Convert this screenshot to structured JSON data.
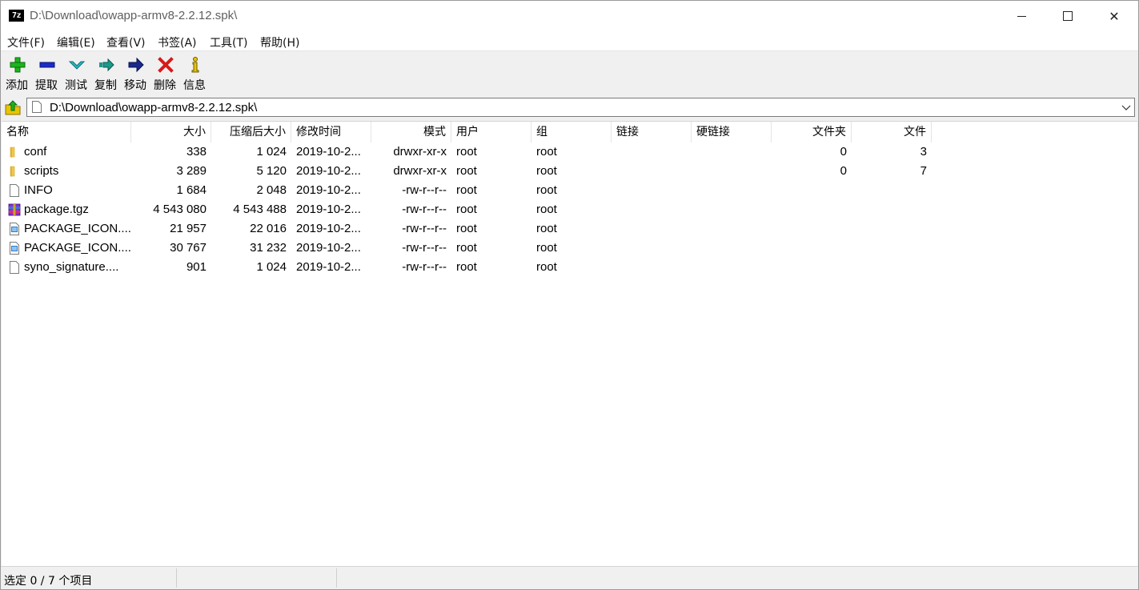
{
  "window": {
    "app_icon_text": "7z",
    "title": "D:\\Download\\owapp-armv8-2.2.12.spk\\",
    "minimize_label": "",
    "maximize_label": "",
    "close_label": "✕"
  },
  "menu": [
    {
      "label": "文件(F)"
    },
    {
      "label": "编辑(E)"
    },
    {
      "label": "查看(V)"
    },
    {
      "label": "书签(A)"
    },
    {
      "label": "工具(T)"
    },
    {
      "label": "帮助(H)"
    }
  ],
  "toolbar": [
    {
      "label": "添加",
      "icon": "add-icon",
      "color": "#1db31d"
    },
    {
      "label": "提取",
      "icon": "extract-icon",
      "color": "#1b2ccc"
    },
    {
      "label": "测试",
      "icon": "test-icon",
      "color": "#27b9c8"
    },
    {
      "label": "复制",
      "icon": "copy-icon",
      "color": "#1a9a8a"
    },
    {
      "label": "移动",
      "icon": "move-icon",
      "color": "#1a2a8a"
    },
    {
      "label": "删除",
      "icon": "delete-icon",
      "color": "#d61a1a"
    },
    {
      "label": "信息",
      "icon": "info-icon",
      "color": "#e8c400"
    }
  ],
  "address": {
    "path": "D:\\Download\\owapp-armv8-2.2.12.spk\\"
  },
  "columns": [
    {
      "label": "名称"
    },
    {
      "label": "大小"
    },
    {
      "label": "压缩后大小"
    },
    {
      "label": "修改时间"
    },
    {
      "label": "模式"
    },
    {
      "label": "用户"
    },
    {
      "label": "组"
    },
    {
      "label": "链接"
    },
    {
      "label": "硬链接"
    },
    {
      "label": "文件夹"
    },
    {
      "label": "文件"
    }
  ],
  "rows": [
    {
      "icon": "folder-icon",
      "name": "conf",
      "size": "338",
      "packed": "1 024",
      "modified": "2019-10-2...",
      "mode": "drwxr-xr-x",
      "user": "root",
      "group": "root",
      "link": "",
      "hardlink": "",
      "folders": "0",
      "files": "3"
    },
    {
      "icon": "folder-icon",
      "name": "scripts",
      "size": "3 289",
      "packed": "5 120",
      "modified": "2019-10-2...",
      "mode": "drwxr-xr-x",
      "user": "root",
      "group": "root",
      "link": "",
      "hardlink": "",
      "folders": "0",
      "files": "7"
    },
    {
      "icon": "file-icon",
      "name": "INFO",
      "size": "1 684",
      "packed": "2 048",
      "modified": "2019-10-2...",
      "mode": "-rw-r--r--",
      "user": "root",
      "group": "root",
      "link": "",
      "hardlink": "",
      "folders": "",
      "files": ""
    },
    {
      "icon": "archive-icon",
      "name": "package.tgz",
      "size": "4 543 080",
      "packed": "4 543 488",
      "modified": "2019-10-2...",
      "mode": "-rw-r--r--",
      "user": "root",
      "group": "root",
      "link": "",
      "hardlink": "",
      "folders": "",
      "files": ""
    },
    {
      "icon": "image-file-icon",
      "name": "PACKAGE_ICON....",
      "size": "21 957",
      "packed": "22 016",
      "modified": "2019-10-2...",
      "mode": "-rw-r--r--",
      "user": "root",
      "group": "root",
      "link": "",
      "hardlink": "",
      "folders": "",
      "files": ""
    },
    {
      "icon": "image-file-icon",
      "name": "PACKAGE_ICON....",
      "size": "30 767",
      "packed": "31 232",
      "modified": "2019-10-2...",
      "mode": "-rw-r--r--",
      "user": "root",
      "group": "root",
      "link": "",
      "hardlink": "",
      "folders": "",
      "files": ""
    },
    {
      "icon": "file-icon",
      "name": "syno_signature....",
      "size": "901",
      "packed": "1 024",
      "modified": "2019-10-2...",
      "mode": "-rw-r--r--",
      "user": "root",
      "group": "root",
      "link": "",
      "hardlink": "",
      "folders": "",
      "files": ""
    }
  ],
  "status": {
    "selection": "选定 0 / 7 个项目"
  }
}
